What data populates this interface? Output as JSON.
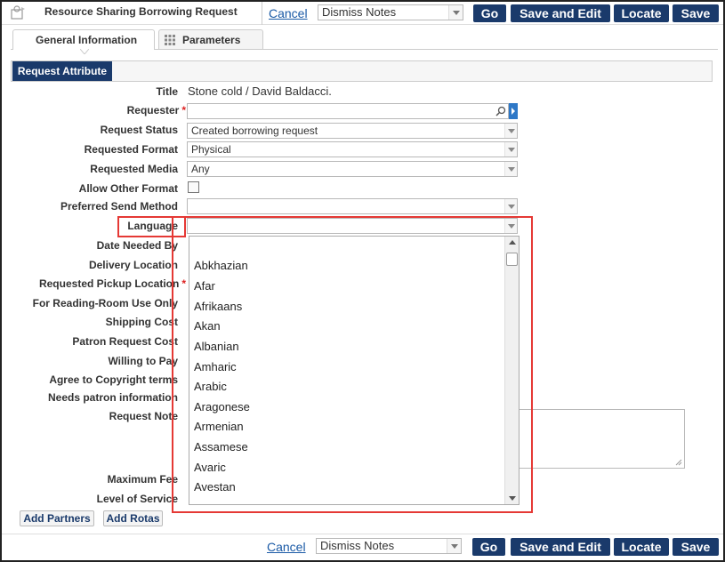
{
  "header": {
    "title": "Resource Sharing Borrowing Request",
    "cancel_label": "Cancel",
    "notes_select": "Dismiss Notes",
    "go_label": "Go",
    "save_edit_label": "Save and Edit",
    "locate_label": "Locate",
    "save_label": "Save"
  },
  "tabs": [
    {
      "label": "General Information",
      "active": true
    },
    {
      "label": "Parameters",
      "active": false
    }
  ],
  "section": {
    "label": "Request Attribute"
  },
  "form": {
    "title_label": "Title",
    "title_value": "Stone cold / David Baldacci.",
    "requester_label": "Requester",
    "requester_value": "",
    "status_label": "Request Status",
    "status_value": "Created borrowing request",
    "format_label": "Requested Format",
    "format_value": "Physical",
    "media_label": "Requested Media",
    "media_value": "Any",
    "allow_other_label": "Allow Other Format",
    "send_method_label": "Preferred Send Method",
    "send_method_value": "",
    "language_label": "Language",
    "language_value": "",
    "date_needed_label": "Date Needed By",
    "delivery_label": "Delivery Location",
    "pickup_label": "Requested Pickup Location",
    "reading_room_label": "For Reading-Room Use Only",
    "shipping_label": "Shipping Cost",
    "patron_cost_label": "Patron Request Cost",
    "willing_label": "Willing to Pay",
    "copyright_label": "Agree to Copyright terms",
    "needs_info_label": "Needs patron information",
    "note_label": "Request Note",
    "max_fee_label": "Maximum Fee",
    "level_label": "Level of Service"
  },
  "buttons": {
    "add_partners": "Add Partners",
    "add_rotas": "Add Rotas"
  },
  "language_dropdown": {
    "options": [
      "",
      "Abkhazian",
      "Afar",
      "Afrikaans",
      "Akan",
      "Albanian",
      "Amharic",
      "Arabic",
      "Aragonese",
      "Armenian",
      "Assamese",
      "Avaric",
      "Avestan"
    ]
  },
  "footer": {
    "cancel_label": "Cancel",
    "notes_select": "Dismiss Notes",
    "go_label": "Go",
    "save_edit_label": "Save and Edit",
    "locate_label": "Locate",
    "save_label": "Save"
  },
  "icons": {
    "app_icon": "resource-sharing-icon",
    "requester_search": "magnifier-icon",
    "parameters_tab": "grid-icon"
  },
  "colors": {
    "primary_button": "#1a3a6b",
    "highlight": "#e53935",
    "link": "#1a5aa6"
  }
}
